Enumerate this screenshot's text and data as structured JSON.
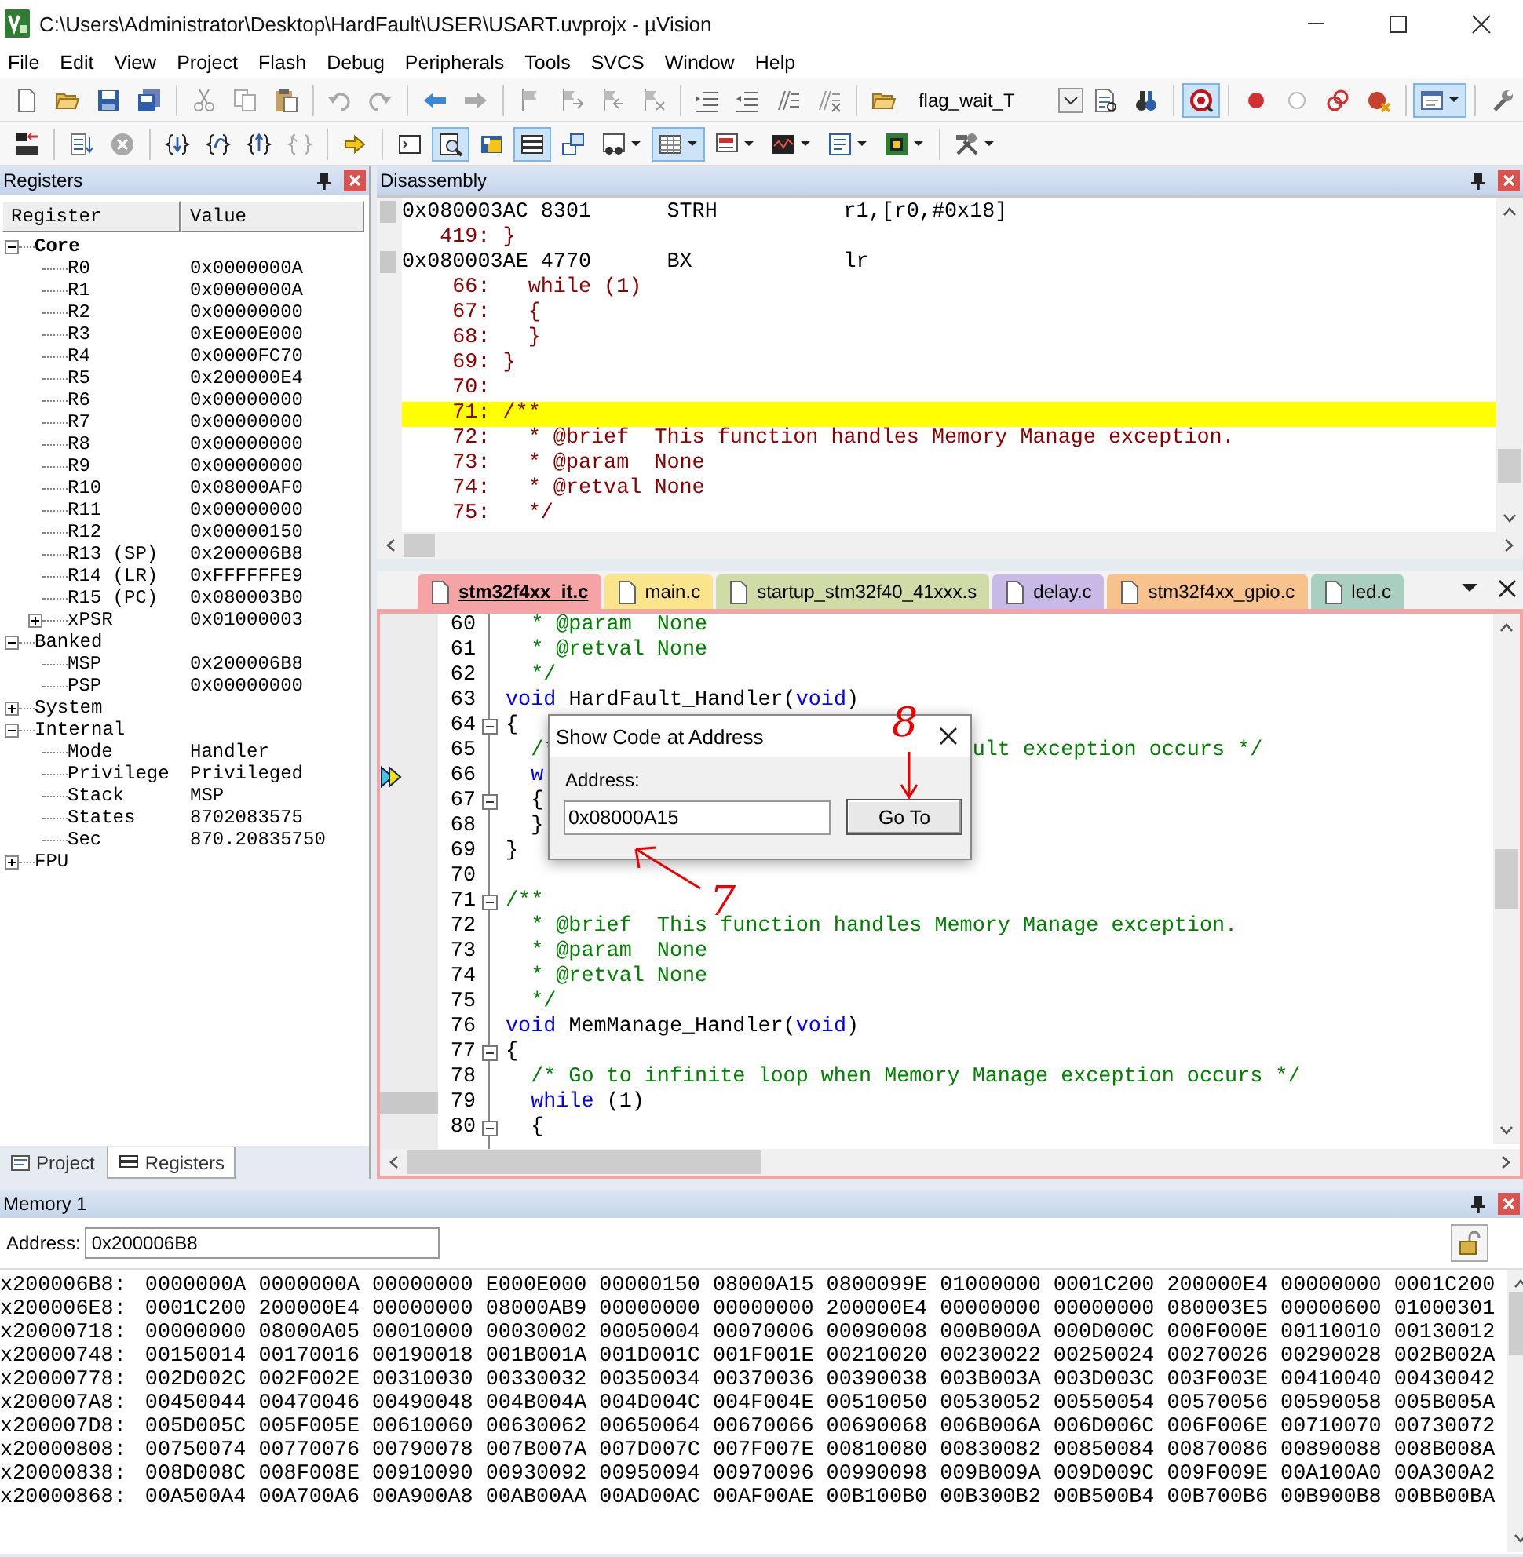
{
  "window": {
    "title": "C:\\Users\\Administrator\\Desktop\\HardFault\\USER\\USART.uvprojx - µVision"
  },
  "menu": [
    "File",
    "Edit",
    "View",
    "Project",
    "Flash",
    "Debug",
    "Peripherals",
    "Tools",
    "SVCS",
    "Window",
    "Help"
  ],
  "toolbar_1": [
    {
      "kind": "new",
      "active": false
    },
    {
      "kind": "open",
      "active": false
    },
    {
      "kind": "save",
      "active": false
    },
    {
      "kind": "saveall",
      "active": false
    },
    {
      "kind": "separator"
    },
    {
      "kind": "cut",
      "active": false
    },
    {
      "kind": "copy",
      "active": false
    },
    {
      "kind": "paste",
      "active": false
    },
    {
      "kind": "separator"
    },
    {
      "kind": "undo",
      "active": false
    },
    {
      "kind": "redo",
      "active": false
    },
    {
      "kind": "separator"
    },
    {
      "kind": "back",
      "active": false
    },
    {
      "kind": "forward",
      "active": false
    },
    {
      "kind": "separator"
    },
    {
      "kind": "flag",
      "active": false
    },
    {
      "kind": "flagnext",
      "active": false
    },
    {
      "kind": "flagprev",
      "active": false
    },
    {
      "kind": "flagclear",
      "active": false
    },
    {
      "kind": "separator"
    },
    {
      "kind": "indent",
      "active": false
    },
    {
      "kind": "outdent",
      "active": false
    },
    {
      "kind": "comment",
      "active": false
    },
    {
      "kind": "uncomment",
      "active": false
    },
    {
      "kind": "separator"
    },
    {
      "kind": "folder",
      "active": false
    },
    {
      "kind": "combo",
      "value": "flag_wait_T"
    },
    {
      "kind": "find",
      "active": false
    },
    {
      "kind": "findref",
      "active": false
    },
    {
      "kind": "separator"
    },
    {
      "kind": "debug",
      "active": true
    },
    {
      "kind": "separator"
    },
    {
      "kind": "bpinsert",
      "active": false
    },
    {
      "kind": "bpenable",
      "active": false
    },
    {
      "kind": "bpdisable",
      "active": false
    },
    {
      "kind": "bpkill",
      "active": false
    },
    {
      "kind": "separator"
    },
    {
      "kind": "winselect",
      "active": true,
      "dropdown": true
    },
    {
      "kind": "separator"
    },
    {
      "kind": "wrench",
      "active": false
    }
  ],
  "toolbar_2": [
    {
      "kind": "reset",
      "active": false
    },
    {
      "kind": "separator"
    },
    {
      "kind": "run",
      "active": false
    },
    {
      "kind": "stop",
      "active": false
    },
    {
      "kind": "separator"
    },
    {
      "kind": "stepinto",
      "active": false
    },
    {
      "kind": "stepover",
      "active": false
    },
    {
      "kind": "stepout",
      "active": false
    },
    {
      "kind": "runcursor",
      "active": false
    },
    {
      "kind": "separator"
    },
    {
      "kind": "showpc",
      "active": false
    },
    {
      "kind": "separator"
    },
    {
      "kind": "cmdwin",
      "active": false
    },
    {
      "kind": "disasmwin",
      "active": true
    },
    {
      "kind": "symbolswin",
      "active": false
    },
    {
      "kind": "regwin",
      "active": true
    },
    {
      "kind": "callstack",
      "active": false
    },
    {
      "kind": "watch",
      "active": false,
      "dropdown": true
    },
    {
      "kind": "memory",
      "active": true,
      "dropdown": true
    },
    {
      "kind": "serial",
      "active": false,
      "dropdown": true
    },
    {
      "kind": "analysis",
      "active": false,
      "dropdown": true
    },
    {
      "kind": "trace",
      "active": false,
      "dropdown": true
    },
    {
      "kind": "sysview",
      "active": false,
      "dropdown": true
    },
    {
      "kind": "separator"
    },
    {
      "kind": "tools",
      "active": false,
      "dropdown": true
    }
  ],
  "registers_panel": {
    "title": "Registers",
    "columns": [
      "Register",
      "Value"
    ],
    "groups": [
      {
        "name": "Core",
        "emphasized": true,
        "expanded": true,
        "children": [
          {
            "name": "R0",
            "value": "0x0000000A"
          },
          {
            "name": "R1",
            "value": "0x0000000A"
          },
          {
            "name": "R2",
            "value": "0x00000000"
          },
          {
            "name": "R3",
            "value": "0xE000E000"
          },
          {
            "name": "R4",
            "value": "0x0000FC70"
          },
          {
            "name": "R5",
            "value": "0x200000E4"
          },
          {
            "name": "R6",
            "value": "0x00000000"
          },
          {
            "name": "R7",
            "value": "0x00000000"
          },
          {
            "name": "R8",
            "value": "0x00000000"
          },
          {
            "name": "R9",
            "value": "0x00000000"
          },
          {
            "name": "R10",
            "value": "0x08000AF0"
          },
          {
            "name": "R11",
            "value": "0x00000000"
          },
          {
            "name": "R12",
            "value": "0x00000150"
          },
          {
            "name": "R13 (SP)",
            "value": "0x200006B8"
          },
          {
            "name": "R14 (LR)",
            "value": "0xFFFFFFE9"
          },
          {
            "name": "R15 (PC)",
            "value": "0x080003B0"
          },
          {
            "name": "xPSR",
            "value": "0x01000003",
            "expanded": false
          }
        ]
      },
      {
        "name": "Banked",
        "emphasized": false,
        "expanded": true,
        "children": [
          {
            "name": "MSP",
            "value": "0x200006B8"
          },
          {
            "name": "PSP",
            "value": "0x00000000"
          }
        ]
      },
      {
        "name": "System",
        "emphasized": false,
        "expanded": false
      },
      {
        "name": "Internal",
        "emphasized": false,
        "expanded": true,
        "children": [
          {
            "name": "Mode",
            "value": "Handler"
          },
          {
            "name": "Privilege",
            "value": "Privileged"
          },
          {
            "name": "Stack",
            "value": "MSP"
          },
          {
            "name": "States",
            "value": "8702083575"
          },
          {
            "name": "Sec",
            "value": "870.20835750"
          }
        ]
      },
      {
        "name": "FPU",
        "emphasized": false,
        "expanded": false
      }
    ],
    "tabs": [
      {
        "label": "Project",
        "selected": false
      },
      {
        "label": "Registers",
        "selected": true
      }
    ]
  },
  "disassembly": {
    "title": "Disassembly",
    "lines": [
      {
        "kind": "asm",
        "address": "0x080003AC",
        "opcode": "8301",
        "mnemonic": "STRH",
        "operands": "r1,[r0,#0x18]",
        "highlighted": false
      },
      {
        "kind": "src",
        "number": "419:",
        "code": "}",
        "highlighted": false
      },
      {
        "kind": "asm",
        "address": "0x080003AE",
        "opcode": "4770",
        "mnemonic": "BX",
        "operands": "lr",
        "highlighted": false
      },
      {
        "kind": "src",
        "number": "66:",
        "code": "  while (1)",
        "highlighted": false
      },
      {
        "kind": "src",
        "number": "67:",
        "code": "  {",
        "highlighted": false
      },
      {
        "kind": "src",
        "number": "68:",
        "code": "  }",
        "highlighted": false
      },
      {
        "kind": "src",
        "number": "69:",
        "code": "}",
        "highlighted": false
      },
      {
        "kind": "src",
        "number": "70:",
        "highlighted": false
      },
      {
        "kind": "src",
        "number": "71:",
        "code": "/**",
        "highlighted": true
      },
      {
        "kind": "src",
        "number": "72:",
        "code": "  * @brief  This function handles Memory Manage exception.",
        "highlighted": false
      },
      {
        "kind": "src",
        "number": "73:",
        "code": "  * @param  None",
        "highlighted": false
      },
      {
        "kind": "src",
        "number": "74:",
        "code": "  * @retval None",
        "highlighted": false
      },
      {
        "kind": "src",
        "number": "75:",
        "code": "  */",
        "highlighted": false
      }
    ]
  },
  "editor": {
    "tabs": [
      {
        "label": "stm32f4xx_it.c",
        "selected": true,
        "color": "#f4a4a4"
      },
      {
        "label": "main.c",
        "selected": false,
        "color": "#fbe58c"
      },
      {
        "label": "startup_stm32f40_41xxx.s",
        "selected": false,
        "color": "#cfdca8"
      },
      {
        "label": "delay.c",
        "selected": false,
        "color": "#c9b9e6"
      },
      {
        "label": "stm32f4xx_gpio.c",
        "selected": false,
        "color": "#f8c28c"
      },
      {
        "label": "led.c",
        "selected": false,
        "color": "#a9cfc0"
      }
    ],
    "lines": [
      {
        "number": "60",
        "collapsible": false,
        "current": false,
        "executable": false,
        "segments": [
          {
            "kind": "comment",
            "text": "  * @param  None"
          }
        ]
      },
      {
        "number": "61",
        "collapsible": false,
        "current": false,
        "executable": false,
        "segments": [
          {
            "kind": "comment",
            "text": "  * @retval None"
          }
        ]
      },
      {
        "number": "62",
        "collapsible": false,
        "current": false,
        "executable": false,
        "segments": [
          {
            "kind": "comment",
            "text": "  */"
          }
        ]
      },
      {
        "number": "63",
        "collapsible": false,
        "current": false,
        "executable": false,
        "segments": [
          {
            "kind": "keyword",
            "text": "void"
          },
          {
            "kind": "plain",
            "text": " HardFault_Handler("
          },
          {
            "kind": "keyword",
            "text": "void"
          },
          {
            "kind": "plain",
            "text": ")"
          }
        ]
      },
      {
        "number": "64",
        "collapsible": true,
        "current": false,
        "executable": false,
        "segments": [
          {
            "kind": "plain",
            "text": "{"
          }
        ]
      },
      {
        "number": "65",
        "collapsible": false,
        "current": false,
        "executable": false,
        "segments": [
          {
            "kind": "comment",
            "text": "  /*"
          },
          {
            "kind": "comment",
            "text": "                                 ult exception occurs */"
          }
        ]
      },
      {
        "number": "66",
        "collapsible": false,
        "current": true,
        "executable": false,
        "segments": [
          {
            "kind": "keyword",
            "text": "  w"
          }
        ]
      },
      {
        "number": "67",
        "collapsible": true,
        "current": false,
        "executable": false,
        "segments": [
          {
            "kind": "plain",
            "text": "  {"
          }
        ]
      },
      {
        "number": "68",
        "collapsible": false,
        "current": false,
        "executable": false,
        "segments": [
          {
            "kind": "plain",
            "text": "  }"
          }
        ]
      },
      {
        "number": "69",
        "collapsible": false,
        "current": false,
        "executable": false,
        "segments": [
          {
            "kind": "plain",
            "text": "}"
          }
        ]
      },
      {
        "number": "70",
        "collapsible": false,
        "current": false,
        "executable": false
      },
      {
        "number": "71",
        "collapsible": true,
        "current": false,
        "executable": false,
        "segments": [
          {
            "kind": "comment",
            "text": "/**"
          }
        ]
      },
      {
        "number": "72",
        "collapsible": false,
        "current": false,
        "executable": false,
        "segments": [
          {
            "kind": "comment",
            "text": "  * @brief  This function handles Memory Manage exception."
          }
        ]
      },
      {
        "number": "73",
        "collapsible": false,
        "current": false,
        "executable": false,
        "segments": [
          {
            "kind": "comment",
            "text": "  * @param  None"
          }
        ]
      },
      {
        "number": "74",
        "collapsible": false,
        "current": false,
        "executable": false,
        "segments": [
          {
            "kind": "comment",
            "text": "  * @retval None"
          }
        ]
      },
      {
        "number": "75",
        "collapsible": false,
        "current": false,
        "executable": false,
        "segments": [
          {
            "kind": "comment",
            "text": "  */"
          }
        ]
      },
      {
        "number": "76",
        "collapsible": false,
        "current": false,
        "executable": false,
        "segments": [
          {
            "kind": "keyword",
            "text": "void"
          },
          {
            "kind": "plain",
            "text": " MemManage_Handler("
          },
          {
            "kind": "keyword",
            "text": "void"
          },
          {
            "kind": "plain",
            "text": ")"
          }
        ]
      },
      {
        "number": "77",
        "collapsible": true,
        "current": false,
        "executable": false,
        "segments": [
          {
            "kind": "plain",
            "text": "{"
          }
        ]
      },
      {
        "number": "78",
        "collapsible": false,
        "current": false,
        "executable": false,
        "segments": [
          {
            "kind": "comment",
            "text": "  /* Go to infinite loop when Memory Manage exception occurs */"
          }
        ]
      },
      {
        "number": "79",
        "collapsible": false,
        "current": false,
        "executable": true,
        "segments": [
          {
            "kind": "keyword",
            "text": "  while"
          },
          {
            "kind": "plain",
            "text": " (1)"
          }
        ]
      },
      {
        "number": "80",
        "collapsible": true,
        "current": false,
        "executable": false,
        "segments": [
          {
            "kind": "plain",
            "text": "  {"
          }
        ]
      }
    ]
  },
  "dialog": {
    "title": "Show Code at Address",
    "address_label": "Address:",
    "address_value": "0x08000A15",
    "button": "Go To"
  },
  "annotations": [
    {
      "text": "8"
    },
    {
      "text": "7"
    }
  ],
  "memory": {
    "title": "Memory 1",
    "address_label": "Address:",
    "address_value": "0x200006B8",
    "rows": [
      {
        "address": "x200006B8:",
        "words": [
          "0000000A",
          "0000000A",
          "00000000",
          "E000E000",
          "00000150",
          "08000A15",
          "0800099E",
          "01000000",
          "0001C200",
          "200000E4",
          "00000000",
          "0001C200"
        ]
      },
      {
        "address": "x200006E8:",
        "words": [
          "0001C200",
          "200000E4",
          "00000000",
          "08000AB9",
          "00000000",
          "00000000",
          "200000E4",
          "00000000",
          "00000000",
          "080003E5",
          "00000600",
          "01000301"
        ]
      },
      {
        "address": "x20000718:",
        "words": [
          "00000000",
          "08000A05",
          "00010000",
          "00030002",
          "00050004",
          "00070006",
          "00090008",
          "000B000A",
          "000D000C",
          "000F000E",
          "00110010",
          "00130012"
        ]
      },
      {
        "address": "x20000748:",
        "words": [
          "00150014",
          "00170016",
          "00190018",
          "001B001A",
          "001D001C",
          "001F001E",
          "00210020",
          "00230022",
          "00250024",
          "00270026",
          "00290028",
          "002B002A"
        ]
      },
      {
        "address": "x20000778:",
        "words": [
          "002D002C",
          "002F002E",
          "00310030",
          "00330032",
          "00350034",
          "00370036",
          "00390038",
          "003B003A",
          "003D003C",
          "003F003E",
          "00410040",
          "00430042"
        ]
      },
      {
        "address": "x200007A8:",
        "words": [
          "00450044",
          "00470046",
          "00490048",
          "004B004A",
          "004D004C",
          "004F004E",
          "00510050",
          "00530052",
          "00550054",
          "00570056",
          "00590058",
          "005B005A"
        ]
      },
      {
        "address": "x200007D8:",
        "words": [
          "005D005C",
          "005F005E",
          "00610060",
          "00630062",
          "00650064",
          "00670066",
          "00690068",
          "006B006A",
          "006D006C",
          "006F006E",
          "00710070",
          "00730072"
        ]
      },
      {
        "address": "x20000808:",
        "words": [
          "00750074",
          "00770076",
          "00790078",
          "007B007A",
          "007D007C",
          "007F007E",
          "00810080",
          "00830082",
          "00850084",
          "00870086",
          "00890088",
          "008B008A"
        ]
      },
      {
        "address": "x20000838:",
        "words": [
          "008D008C",
          "008F008E",
          "00910090",
          "00930092",
          "00950094",
          "00970096",
          "00990098",
          "009B009A",
          "009D009C",
          "009F009E",
          "00A100A0",
          "00A300A2"
        ]
      },
      {
        "address": "x20000868:",
        "words": [
          "00A500A4",
          "00A700A6",
          "00A900A8",
          "00AB00AA",
          "00AD00AC",
          "00AF00AE",
          "00B100B0",
          "00B300B2",
          "00B500B4",
          "00B700B6",
          "00B900B8",
          "00BB00BA"
        ]
      }
    ]
  }
}
